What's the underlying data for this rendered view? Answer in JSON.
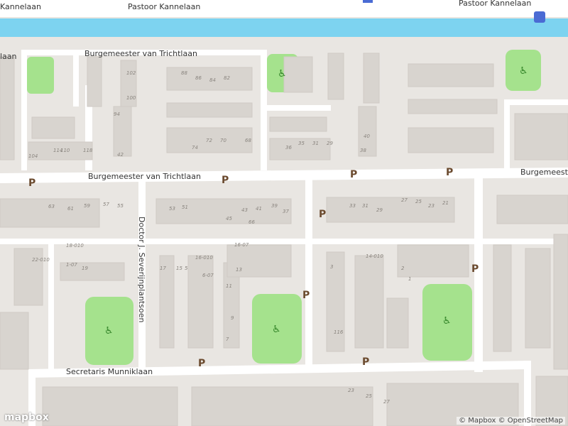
{
  "map": {
    "streets": {
      "top": "Pastoor Kannelaan",
      "top_left": "Kannelaan",
      "top_right": "Pastoor Kannelaan",
      "north": "Burgemeester van Trichtlaan",
      "middle": "Burgemeester van Trichtlaan",
      "middle_right": "Burgemeester",
      "vertical": "Doctor J. Severijnplantsoen",
      "south": "Secretaris Munniklaan",
      "left_edge": "laan"
    },
    "parking_label": "P",
    "house_numbers": [
      "88",
      "86",
      "84",
      "82",
      "74",
      "72",
      "70",
      "68",
      "66",
      "63",
      "61",
      "59",
      "57",
      "55",
      "53",
      "51",
      "45",
      "43",
      "41",
      "39",
      "37",
      "33",
      "31",
      "29",
      "27",
      "25",
      "23",
      "21",
      "19",
      "17",
      "15",
      "13",
      "11",
      "9",
      "7",
      "5",
      "3",
      "2",
      "1",
      "16-010",
      "14-010",
      "16-07",
      "18-010",
      "22-010",
      "6-07",
      "1-07",
      "116",
      "114",
      "110",
      "118",
      "104",
      "102",
      "100",
      "94",
      "42",
      "40",
      "38",
      "36",
      "35",
      "31",
      "29",
      "27",
      "25",
      "23"
    ],
    "colors": {
      "water": "#7dd3f0",
      "park": "#a5e28d",
      "road": "#ffffff",
      "building": "#d8d4cf",
      "land": "#e9e6e2"
    }
  },
  "attribution": {
    "copyright_mapbox": "© Mapbox",
    "copyright_osm": "© OpenStreetMap",
    "logo_text": "mapbox"
  }
}
